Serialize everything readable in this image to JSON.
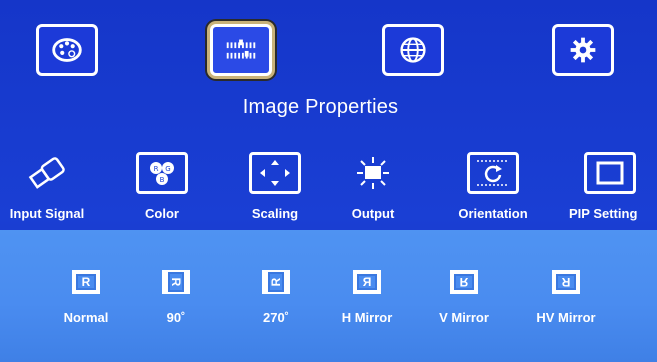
{
  "menu": {
    "title": "Image Properties",
    "top_icons": [
      {
        "icon": "palette-icon",
        "selected": false
      },
      {
        "icon": "sliders-icon",
        "selected": true
      },
      {
        "icon": "globe-icon",
        "selected": false
      },
      {
        "icon": "gear-icon",
        "selected": false
      }
    ]
  },
  "submenu": {
    "items": [
      {
        "label": "Input Signal",
        "icon": "usb-plug-icon"
      },
      {
        "label": "Color",
        "icon": "color-circles-icon"
      },
      {
        "label": "Scaling",
        "icon": "expand-arrows-icon"
      },
      {
        "label": "Output",
        "icon": "sun-monitor-icon"
      },
      {
        "label": "Orientation",
        "icon": "rotate-film-icon"
      },
      {
        "label": "PIP Setting",
        "icon": "pip-window-icon"
      }
    ]
  },
  "orientation": {
    "options": [
      {
        "label": "Normal",
        "glyph": "R"
      },
      {
        "label": "90˚",
        "glyph": "R"
      },
      {
        "label": "270˚",
        "glyph": "R"
      },
      {
        "label": "H Mirror",
        "glyph": "R"
      },
      {
        "label": "V Mirror",
        "glyph": "R"
      },
      {
        "label": "HV Mirror",
        "glyph": "R"
      }
    ]
  },
  "colors": {
    "menu_background": "#1a3fd4",
    "panel_background": "#4a8cf0",
    "selection_frame": "#c9b37a",
    "text": "#ffffff"
  }
}
